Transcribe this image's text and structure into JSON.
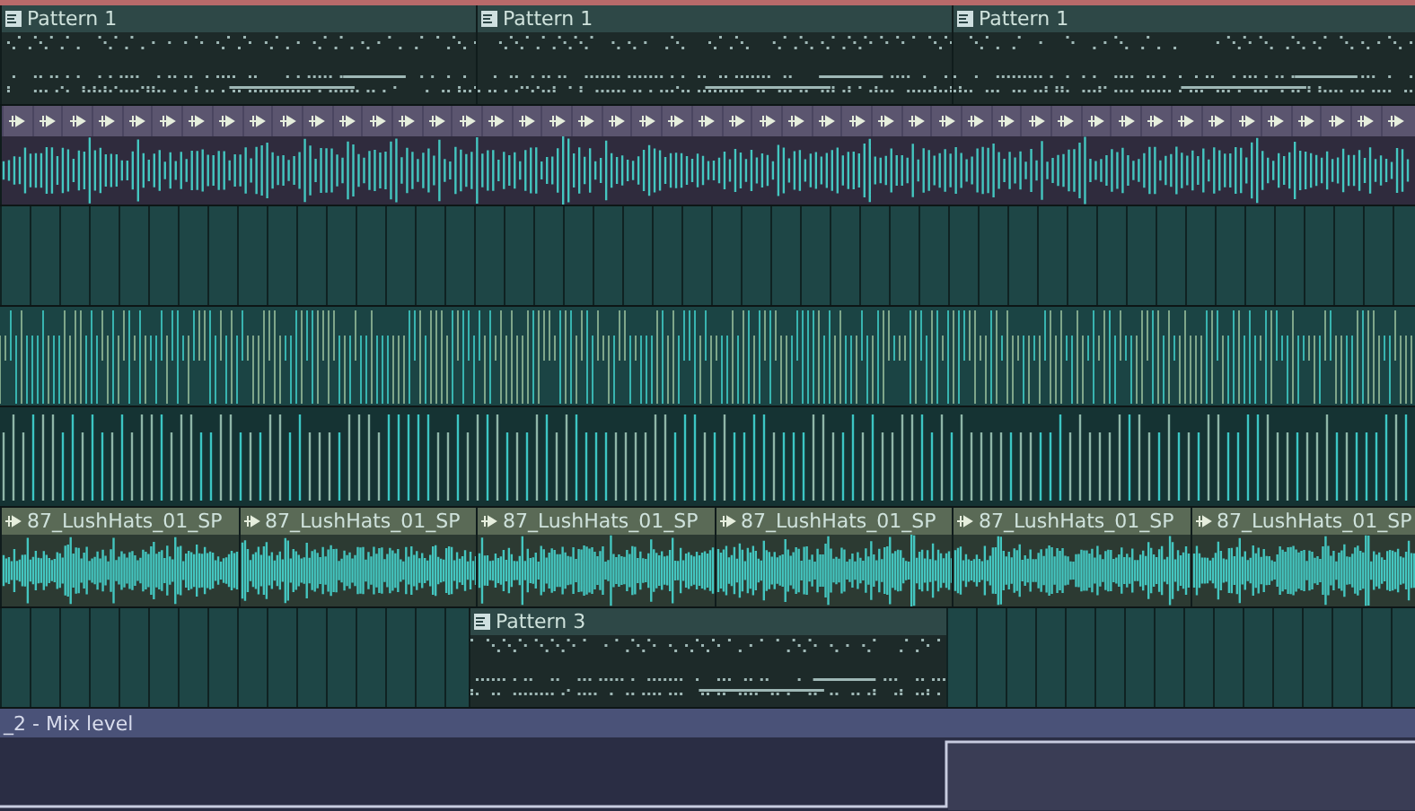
{
  "tracks": [
    {
      "kind": "pattern",
      "clips": [
        {
          "label": "Pattern 1"
        },
        {
          "label": "Pattern 1"
        },
        {
          "label": "Pattern 1"
        }
      ]
    },
    {
      "kind": "slices"
    },
    {
      "kind": "empty"
    },
    {
      "kind": "dense"
    },
    {
      "kind": "bars"
    },
    {
      "kind": "audio",
      "clips": [
        {
          "label": "87_LushHats_01_SP"
        },
        {
          "label": "87_LushHats_01_SP"
        },
        {
          "label": "87_LushHats_01_SP"
        },
        {
          "label": "87_LushHats_01_SP"
        },
        {
          "label": "87_LushHats_01_SP"
        },
        {
          "label": "87_LushHats_01_SP"
        }
      ]
    },
    {
      "kind": "gap-pattern",
      "clips": [
        {
          "label": "Pattern 3"
        }
      ]
    }
  ],
  "automation": {
    "title": "_2 - Mix level"
  }
}
